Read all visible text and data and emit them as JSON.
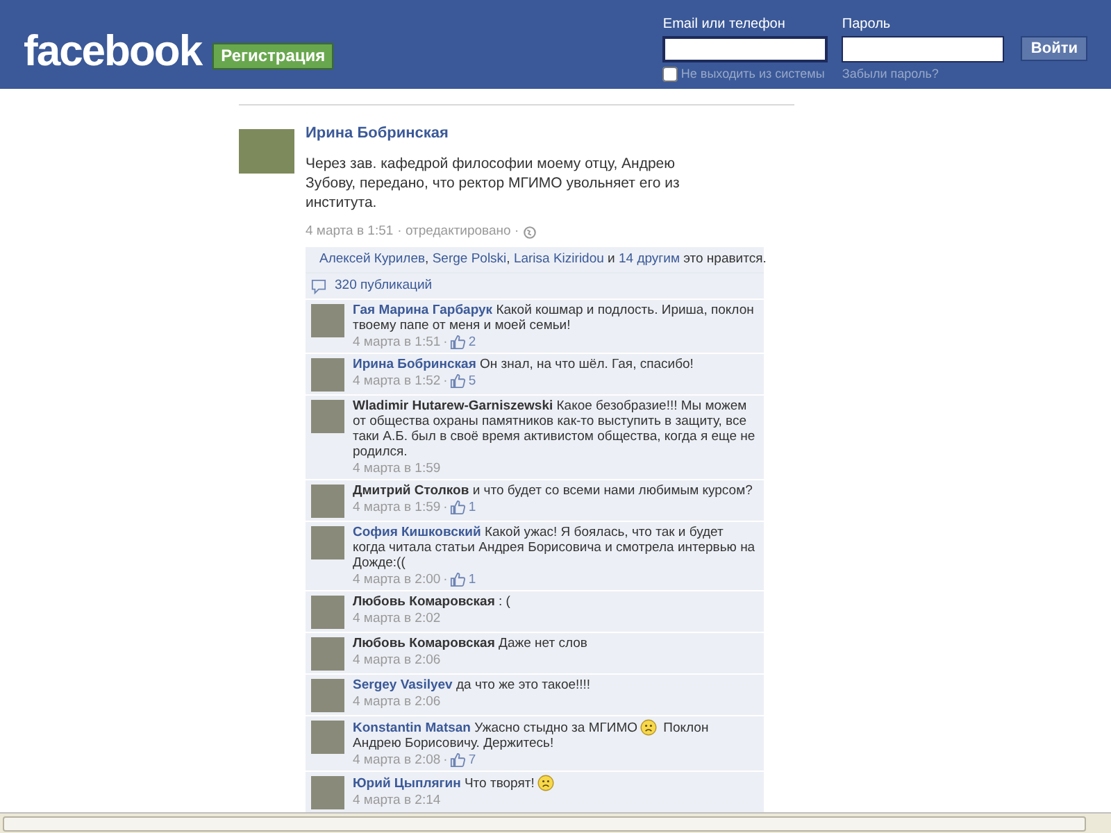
{
  "header": {
    "logo": "facebook",
    "signup": "Регистрация",
    "email_label": "Email или телефон",
    "password_label": "Пароль",
    "remember": {
      "label": "Не выходить из системы",
      "checked": false
    },
    "forgot": "Забыли пароль?",
    "login": "Войти"
  },
  "post": {
    "author": "Ирина Бобринская",
    "text": "Через зав. кафедрой философии моему отцу, Андрею Зубову, передано, что ректор МГИМО увольняет его из института.",
    "time": "4 марта в 1:51",
    "edited": "· отредактировано ·",
    "dot": "·",
    "likers": [
      "Алексей Курилев",
      "Serge Polski",
      "Larisa Kiziridou"
    ],
    "likers_sep": ", ",
    "likers_and": "и",
    "likers_others": "14 другим",
    "likes_suffix": "это нравится.",
    "shares": "320 публикаций"
  },
  "comments": [
    {
      "author": "Гая Марина Гарбарук",
      "linked": true,
      "text": "Какой кошмар и подлость. Ириша, поклон твоему папе от меня и моей семьи!",
      "time": "4 марта в 1:51",
      "likes": "2"
    },
    {
      "author": "Ирина Бобринская",
      "linked": true,
      "text": "Он знал, на что шёл. Гая, спасибо!",
      "time": "4 марта в 1:52",
      "likes": "5"
    },
    {
      "author": "Wladimir Hutarew-Garniszewski",
      "linked": false,
      "text": "Какое безобразие!!! Мы можем от общества охраны памятников как-то выступить в защиту, все таки А.Б. был в своё время активистом общества, когда я еще не родился.",
      "time": "4 марта в 1:59"
    },
    {
      "author": "Дмитрий Столков",
      "linked": false,
      "text": "и что будет со всеми нами любимым курсом?",
      "time": "4 марта в 1:59",
      "likes": "1"
    },
    {
      "author": "София Кишковский",
      "linked": true,
      "text": "Какой ужас! Я боялась, что так и будет когда читала статьи Андрея Борисовича и смотрела интервью на Дожде:((",
      "time": "4 марта в 2:00",
      "likes": "1"
    },
    {
      "author": "Любовь Комаровская",
      "linked": false,
      "text": ": (",
      "time": "4 марта в 2:02"
    },
    {
      "author": "Любовь Комаровская",
      "linked": false,
      "text": "Даже нет слов",
      "time": "4 марта в 2:06"
    },
    {
      "author": "Sergey Vasilyev",
      "linked": true,
      "text": "да что же это такое!!!!",
      "time": "4 марта в 2:06"
    },
    {
      "author": "Konstantin Matsan",
      "linked": true,
      "text": "Ужасно стыдно за МГИМО",
      "emoji": true,
      "text_after": "Поклон Андрею Борисовичу. Держитесь!",
      "time": "4 марта в 2:08",
      "likes": "7"
    },
    {
      "author": "Юрий Цыплягин",
      "linked": true,
      "text": "Что творят!",
      "emoji": true,
      "time": "4 марта в 2:14"
    }
  ]
}
